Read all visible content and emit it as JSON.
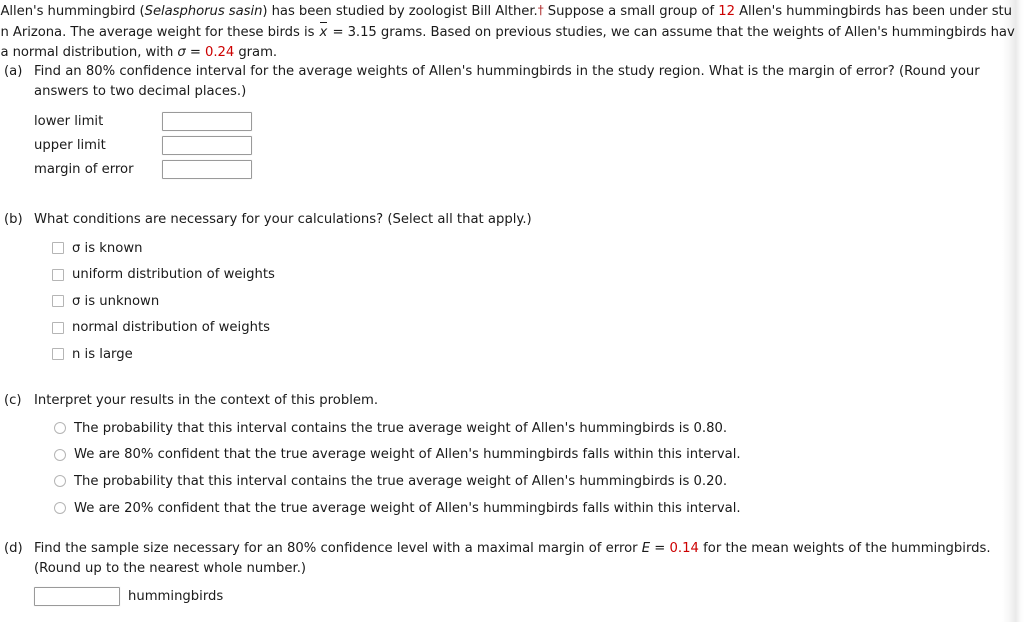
{
  "problem": {
    "line1_part1": "Allen's hummingbird (",
    "line1_species": "Selasphorus sasin",
    "line1_part2": ") has been studied by zoologist Bill Alther.",
    "line1_dagger": "†",
    "line1_part3": " Suppose a small group of ",
    "line1_n": "12",
    "line1_part4": " Allen's hummingbirds has been under stu",
    "line2_part1": "n Arizona. The average weight for these birds is ",
    "line2_xbar": "x",
    "line2_part2": " = 3.15 grams. Based on previous studies, we can assume that the weights of Allen's hummingbirds hav",
    "line3_part1": "a normal distribution, with ",
    "line3_sigma": "σ",
    "line3_part2": " = ",
    "line3_sigma_value": "0.24",
    "line3_part3": " gram."
  },
  "parts": {
    "a": {
      "label": "(a)",
      "prompt_line1": "Find an 80% confidence interval for the average weights of Allen's hummingbirds in the study region. What is the margin of error? (Round your",
      "prompt_line2": "answers to two decimal places.)",
      "fields": [
        {
          "label": "lower limit",
          "value": "",
          "placeholder": ""
        },
        {
          "label": "upper limit",
          "value": "",
          "placeholder": ""
        },
        {
          "label": "margin of error",
          "value": "",
          "placeholder": ""
        }
      ]
    },
    "b": {
      "label": "(b)",
      "prompt": "What conditions are necessary for your calculations? (Select all that apply.)",
      "options": [
        {
          "text": "σ is known",
          "checked": false
        },
        {
          "text": "uniform distribution of weights",
          "checked": false
        },
        {
          "text": "σ is unknown",
          "checked": false
        },
        {
          "text": "normal distribution of weights",
          "checked": false
        },
        {
          "text": "n is large",
          "checked": false
        }
      ]
    },
    "c": {
      "label": "(c)",
      "prompt": "Interpret your results in the context of this problem.",
      "options": [
        {
          "text": "The probability that this interval contains the true average weight of Allen's hummingbirds is 0.80.",
          "selected": false
        },
        {
          "text": "We are 80% confident that the true average weight of Allen's hummingbirds falls within this interval.",
          "selected": false
        },
        {
          "text": "The probability that this interval contains the true average weight of Allen's hummingbirds is 0.20.",
          "selected": false
        },
        {
          "text": "We are 20% confident that the true average weight of Allen's hummingbirds falls within this interval.",
          "selected": false
        }
      ]
    },
    "d": {
      "label": "(d)",
      "prompt_pre": "Find the sample size necessary for an 80% confidence level with a maximal margin of error ",
      "prompt_E": "E",
      "prompt_eq": " = ",
      "prompt_E_value": "0.14",
      "prompt_post": " for the mean weights of the hummingbirds.",
      "prompt_line2": "(Round up to the nearest whole number.)",
      "answer": {
        "value": "",
        "placeholder": "",
        "unit": "hummingbirds"
      }
    }
  },
  "colors": {
    "highlight": "#cc0000",
    "text": "#1a1a1a",
    "background": "#ffffff",
    "field_border": "#9a9a9a",
    "control_border": "#b5b5b5"
  }
}
